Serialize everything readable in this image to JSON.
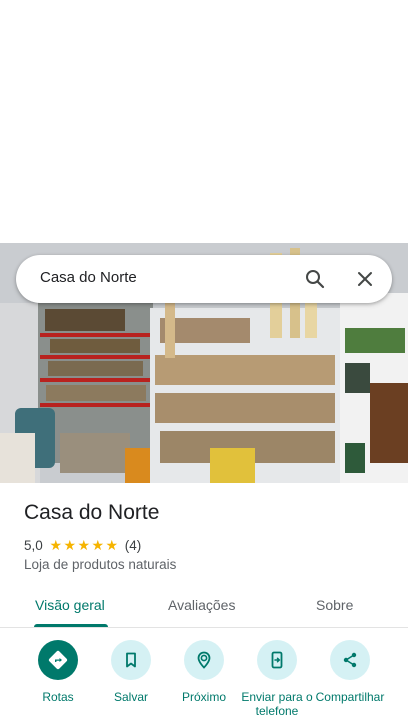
{
  "search": {
    "query": "Casa do Norte"
  },
  "place": {
    "name": "Casa do Norte",
    "rating": "5,0",
    "review_count": "(4)",
    "stars": 5,
    "category": "Loja de produtos naturais"
  },
  "tabs": [
    {
      "label": "Visão geral",
      "active": true
    },
    {
      "label": "Avaliações",
      "active": false
    },
    {
      "label": "Sobre",
      "active": false
    }
  ],
  "actions": [
    {
      "label": "Rotas",
      "icon": "directions-icon"
    },
    {
      "label": "Salvar",
      "icon": "bookmark-icon"
    },
    {
      "label": "Próximo",
      "icon": "nearby-icon"
    },
    {
      "label": "Enviar para o telefone",
      "icon": "send-to-phone-icon"
    },
    {
      "label": "Compartilhar",
      "icon": "share-icon"
    }
  ],
  "colors": {
    "accent": "#00796b",
    "action_bg": "#d5f1f4",
    "star": "#f6b400"
  }
}
